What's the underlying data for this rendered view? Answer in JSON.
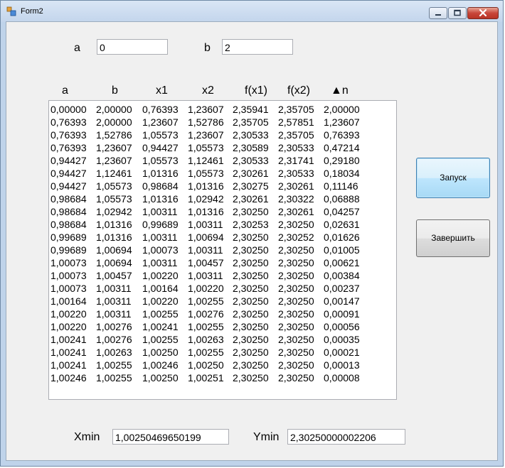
{
  "window": {
    "title": "Form2"
  },
  "inputs": {
    "a_label": "a",
    "a_value": "0",
    "b_label": "b",
    "b_value": "2"
  },
  "table": {
    "headers": [
      "a",
      "b",
      "x1",
      "x2",
      "f(x1)",
      "f(x2)",
      "▲n"
    ],
    "rows": [
      [
        "0,00000",
        "2,00000",
        "0,76393",
        "1,23607",
        "2,35941",
        "2,35705",
        "2,00000"
      ],
      [
        "0,76393",
        "2,00000",
        "1,23607",
        "1,52786",
        "2,35705",
        "2,57851",
        "1,23607"
      ],
      [
        "0,76393",
        "1,52786",
        "1,05573",
        "1,23607",
        "2,30533",
        "2,35705",
        "0,76393"
      ],
      [
        "0,76393",
        "1,23607",
        "0,94427",
        "1,05573",
        "2,30589",
        "2,30533",
        "0,47214"
      ],
      [
        "0,94427",
        "1,23607",
        "1,05573",
        "1,12461",
        "2,30533",
        "2,31741",
        "0,29180"
      ],
      [
        "0,94427",
        "1,12461",
        "1,01316",
        "1,05573",
        "2,30261",
        "2,30533",
        "0,18034"
      ],
      [
        "0,94427",
        "1,05573",
        "0,98684",
        "1,01316",
        "2,30275",
        "2,30261",
        "0,11146"
      ],
      [
        "0,98684",
        "1,05573",
        "1,01316",
        "1,02942",
        "2,30261",
        "2,30322",
        "0,06888"
      ],
      [
        "0,98684",
        "1,02942",
        "1,00311",
        "1,01316",
        "2,30250",
        "2,30261",
        "0,04257"
      ],
      [
        "0,98684",
        "1,01316",
        "0,99689",
        "1,00311",
        "2,30253",
        "2,30250",
        "0,02631"
      ],
      [
        "0,99689",
        "1,01316",
        "1,00311",
        "1,00694",
        "2,30250",
        "2,30252",
        "0,01626"
      ],
      [
        "0,99689",
        "1,00694",
        "1,00073",
        "1,00311",
        "2,30250",
        "2,30250",
        "0,01005"
      ],
      [
        "1,00073",
        "1,00694",
        "1,00311",
        "1,00457",
        "2,30250",
        "2,30250",
        "0,00621"
      ],
      [
        "1,00073",
        "1,00457",
        "1,00220",
        "1,00311",
        "2,30250",
        "2,30250",
        "0,00384"
      ],
      [
        "1,00073",
        "1,00311",
        "1,00164",
        "1,00220",
        "2,30250",
        "2,30250",
        "0,00237"
      ],
      [
        "1,00164",
        "1,00311",
        "1,00220",
        "1,00255",
        "2,30250",
        "2,30250",
        "0,00147"
      ],
      [
        "1,00220",
        "1,00311",
        "1,00255",
        "1,00276",
        "2,30250",
        "2,30250",
        "0,00091"
      ],
      [
        "1,00220",
        "1,00276",
        "1,00241",
        "1,00255",
        "2,30250",
        "2,30250",
        "0,00056"
      ],
      [
        "1,00241",
        "1,00276",
        "1,00255",
        "1,00263",
        "2,30250",
        "2,30250",
        "0,00035"
      ],
      [
        "1,00241",
        "1,00263",
        "1,00250",
        "1,00255",
        "2,30250",
        "2,30250",
        "0,00021"
      ],
      [
        "1,00241",
        "1,00255",
        "1,00246",
        "1,00250",
        "2,30250",
        "2,30250",
        "0,00013"
      ],
      [
        "1,00246",
        "1,00255",
        "1,00250",
        "1,00251",
        "2,30250",
        "2,30250",
        "0,00008"
      ]
    ]
  },
  "buttons": {
    "start_label": "Запуск",
    "finish_label": "Завершить"
  },
  "results": {
    "xmin_label": "Xmin",
    "xmin_value": "1,00250469650199",
    "ymin_label": "Ymin",
    "ymin_value": "2,30250000002206"
  }
}
